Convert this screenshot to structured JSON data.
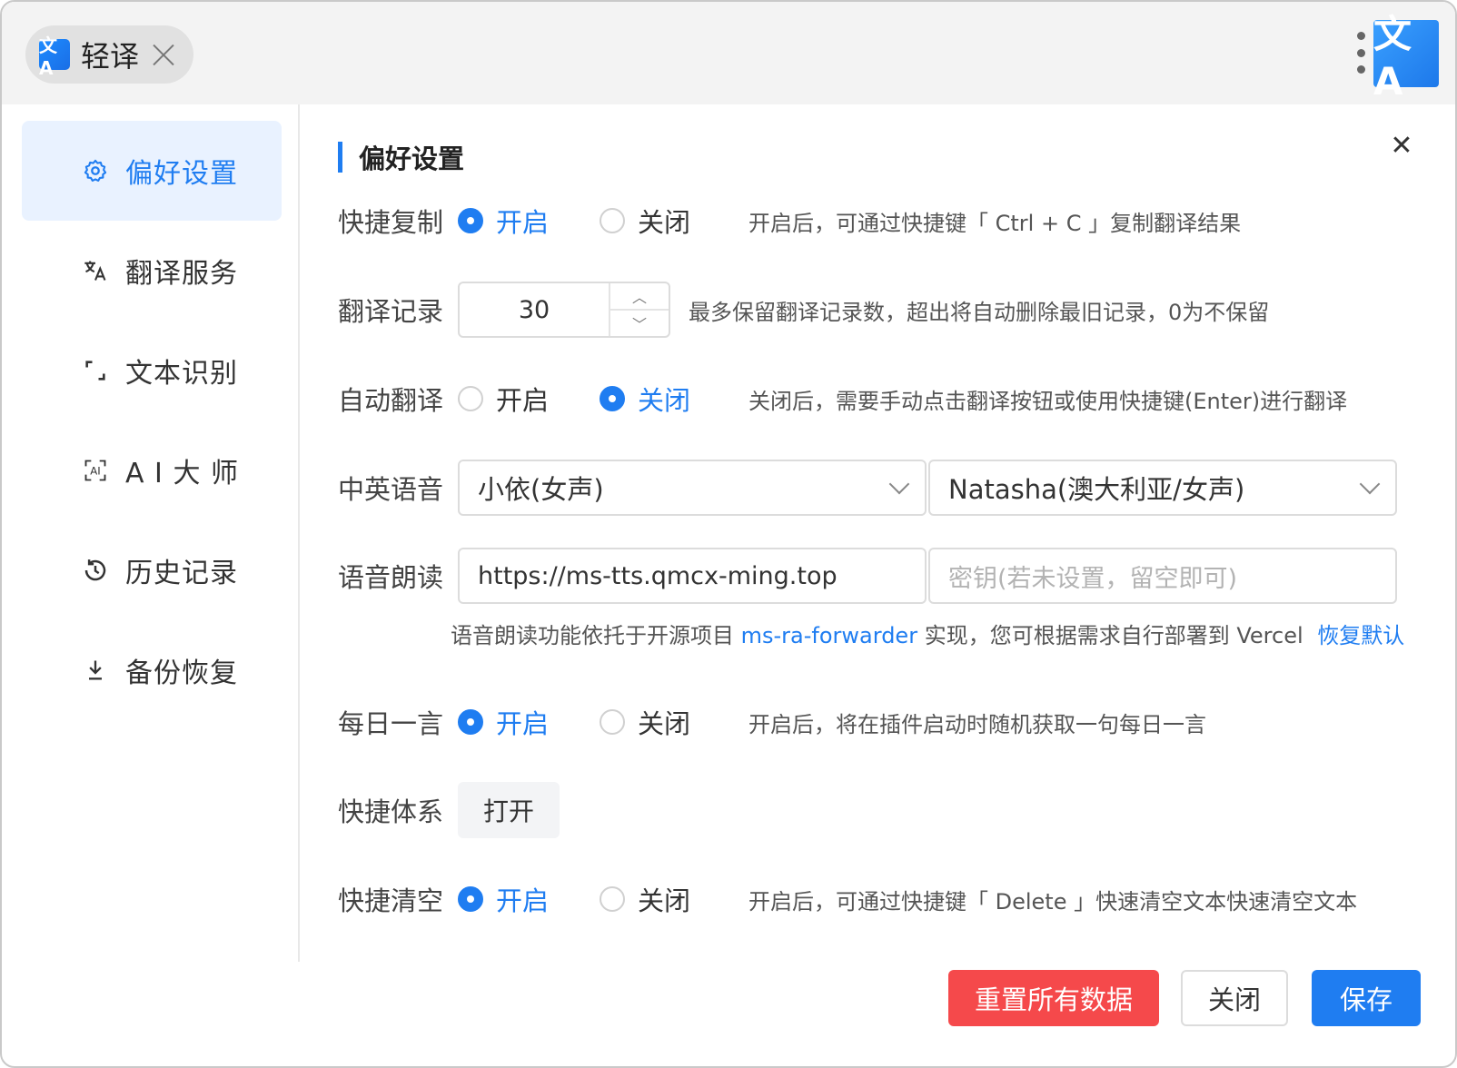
{
  "titlebar": {
    "app_name": "轻译",
    "logo_glyph": "文A"
  },
  "sidebar": {
    "items": [
      {
        "label": "偏好设置",
        "icon": "gear-icon"
      },
      {
        "label": "翻译服务",
        "icon": "translate-icon"
      },
      {
        "label": "文本识别",
        "icon": "scan-icon"
      },
      {
        "label": "A I 大 师",
        "icon": "ai-icon"
      },
      {
        "label": "历史记录",
        "icon": "history-icon"
      },
      {
        "label": "备份恢复",
        "icon": "download-icon"
      }
    ],
    "active_index": 0
  },
  "main": {
    "title": "偏好设置",
    "rows": {
      "quick_copy": {
        "label": "快捷复制",
        "on": "开启",
        "off": "关闭",
        "selected": "on",
        "hint": "开启后，可通过快捷键「 Ctrl + C 」复制翻译结果"
      },
      "history": {
        "label": "翻译记录",
        "value": "30",
        "hint": "最多保留翻译记录数，超出将自动删除最旧记录，0为不保留"
      },
      "auto_translate": {
        "label": "自动翻译",
        "on": "开启",
        "off": "关闭",
        "selected": "off",
        "hint": "关闭后，需要手动点击翻译按钮或使用快捷键(Enter)进行翻译"
      },
      "voice": {
        "label": "中英语音",
        "zh_voice": "小依(女声)",
        "en_voice": "Natasha(澳大利亚/女声)"
      },
      "tts": {
        "label": "语音朗读",
        "url": "https://ms-tts.qmcx-ming.top",
        "key_placeholder": "密钥(若未设置，留空即可)",
        "note_prefix": "语音朗读功能依托于开源项目",
        "note_link": "ms-ra-forwarder",
        "note_suffix": "实现，您可根据需求自行部署到 Vercel",
        "restore_default": "恢复默认"
      },
      "daily_quote": {
        "label": "每日一言",
        "on": "开启",
        "off": "关闭",
        "selected": "on",
        "hint": "开启后，将在插件启动时随机获取一句每日一言"
      },
      "shortcut_system": {
        "label": "快捷体系",
        "button": "打开"
      },
      "quick_clear": {
        "label": "快捷清空",
        "on": "开启",
        "off": "关闭",
        "selected": "on",
        "hint": "开启后，可通过快捷键「 Delete 」快速清空文本快速清空文本"
      }
    }
  },
  "footer": {
    "reset": "重置所有数据",
    "close": "关闭",
    "save": "保存"
  },
  "colors": {
    "accent": "#1f7df1",
    "danger": "#f5494b",
    "active_bg": "#e9f2ff"
  }
}
